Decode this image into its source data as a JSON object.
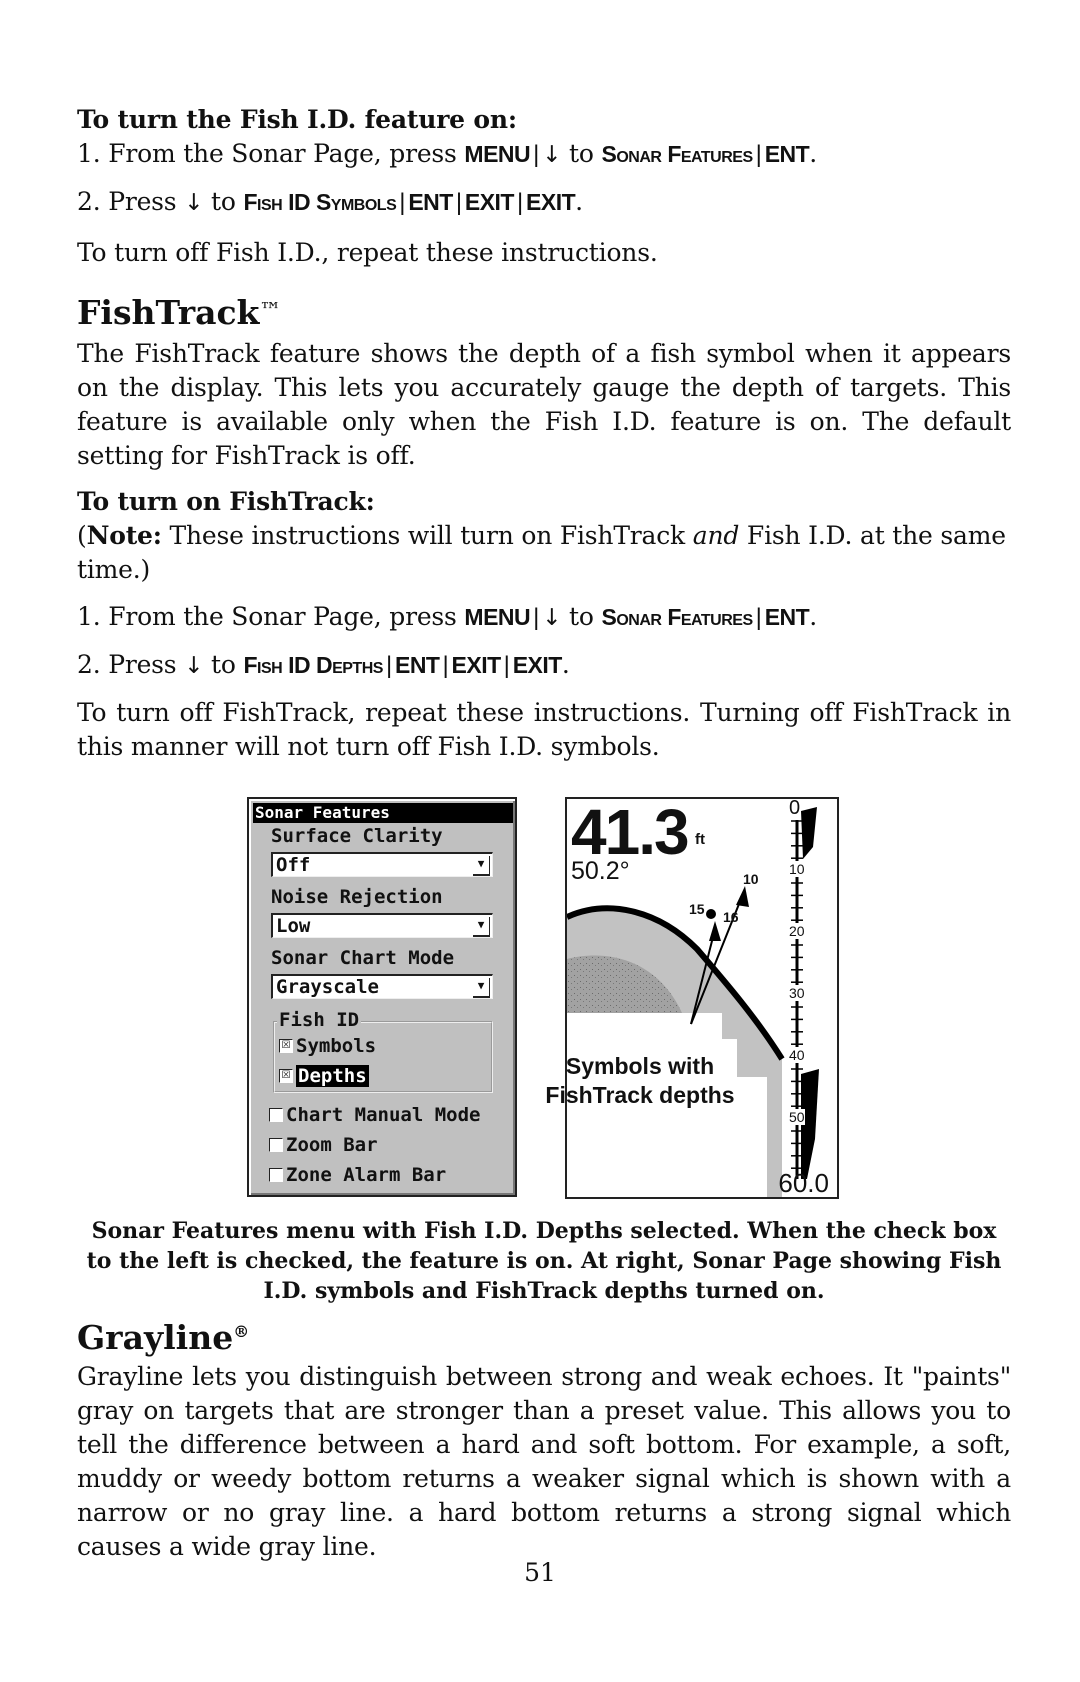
{
  "section1": {
    "heading": "To turn the Fish I.D. feature on:",
    "step1": {
      "prefix": "1. From the Sonar Page, press ",
      "k1": "MENU",
      "arrow": "↓",
      "to": " to ",
      "k2": "Sonar Features",
      "k3": "ENT",
      "end": "."
    },
    "step2": {
      "prefix": "2. Press ",
      "arrow": "↓",
      "to": " to ",
      "k1": "Fish ID Symbols",
      "k2": "ENT",
      "k3": "EXIT",
      "k4": "EXIT",
      "end": "."
    },
    "off": "To turn off Fish I.D., repeat these instructions."
  },
  "fishtrack": {
    "title": "FishTrack",
    "tm": "™",
    "body": "The FishTrack feature shows the depth of a fish symbol when it appears on the display. This lets you accurately gauge the depth of targets. This feature is available only when the Fish I.D. feature is on. The default setting for FishTrack is off.",
    "subheading": "To turn on FishTrack:",
    "note_open": "(",
    "note_label": "Note:",
    "note_a": " These instructions will turn on FishTrack ",
    "note_em": "and",
    "note_b": " Fish I.D. at the same time.)",
    "step1": {
      "prefix": "1. From the Sonar Page, press ",
      "k1": "MENU",
      "arrow": "↓",
      "to": " to ",
      "k2": "Sonar Features",
      "k3": "ENT",
      "end": "."
    },
    "step2": {
      "prefix": "2. Press ",
      "arrow": "↓",
      "to": " to ",
      "k1": "Fish ID Depths",
      "k2": "ENT",
      "k3": "EXIT",
      "k4": "EXIT",
      "end": "."
    },
    "off": "To turn off FishTrack, repeat these instructions. Turning off FishTrack in this manner will not turn off Fish I.D. symbols."
  },
  "menu": {
    "title": "Sonar Features",
    "surface_clarity_label": "Surface Clarity",
    "surface_clarity_value": "Off",
    "noise_rejection_label": "Noise Rejection",
    "noise_rejection_value": "Low",
    "chart_mode_label": "Sonar Chart Mode",
    "chart_mode_value": "Grayscale",
    "fish_id_group": "Fish ID",
    "symbols_label": "Symbols",
    "symbols_checked": true,
    "depths_label": "Depths",
    "depths_checked": true,
    "chart_manual_label": "Chart Manual Mode",
    "zoom_bar_label": "Zoom Bar",
    "zone_alarm_label": "Zone Alarm Bar",
    "checked_glyph": "☒",
    "dropdown_glyph": "▼"
  },
  "sonar": {
    "depth": "41.3",
    "depth_unit": "ft",
    "temperature": "50.2°",
    "scale_top": "0",
    "scale_labels": [
      "10",
      "20",
      "30",
      "40",
      "50"
    ],
    "range_bottom": "60.0",
    "fish": [
      {
        "label": "10"
      },
      {
        "label": "15"
      },
      {
        "label": "16"
      }
    ],
    "callout": "Symbols with FishTrack depths"
  },
  "caption": "Sonar Features menu with Fish I.D. Depths selected. When the check box to the left is checked, the feature is on. At right, Sonar Page showing Fish I.D. symbols and FishTrack depths turned on.",
  "grayline": {
    "title": "Grayline",
    "reg": "®",
    "body": "Grayline lets you distinguish between strong and weak echoes. It \"paints\" gray on targets that are stronger than a preset value. This allows you to tell the difference between a hard and soft bottom. For example, a soft, muddy or weedy bottom returns a weaker signal which is shown with a narrow or no gray line. a hard bottom returns a strong signal which causes a wide gray line."
  },
  "page_number": "51"
}
